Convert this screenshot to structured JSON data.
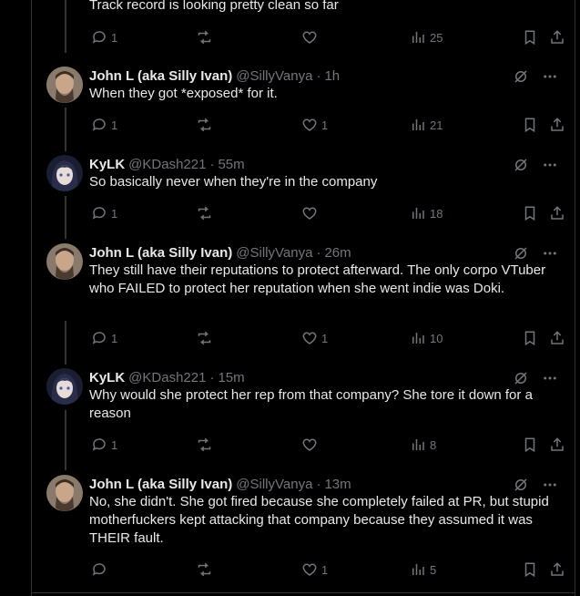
{
  "top_partial": {
    "text": "Track record is looking pretty clean so far",
    "replies": "1",
    "reposts": "",
    "likes": "",
    "views": "25"
  },
  "tweets": [
    {
      "name": "John L (aka Silly Ivan)",
      "handle": "@SillyVanya",
      "time": "1h",
      "text": "When they got *exposed* for it.",
      "replies": "1",
      "reposts": "",
      "likes": "1",
      "views": "21",
      "avatar": "man-avatar"
    },
    {
      "name": "KyLK",
      "handle": "@KDash221",
      "time": "55m",
      "text": "So basically never when they're in the company",
      "replies": "1",
      "reposts": "",
      "likes": "",
      "views": "18",
      "avatar": "anime-avatar"
    },
    {
      "name": "John L (aka Silly Ivan)",
      "handle": "@SillyVanya",
      "time": "26m",
      "text": "They still have their reputations to protect afterward. The only corpo VTuber who FAILED to protect her reputation when she went indie was Doki.",
      "replies": "1",
      "reposts": "",
      "likes": "1",
      "views": "10",
      "avatar": "man-avatar"
    },
    {
      "name": "KyLK",
      "handle": "@KDash221",
      "time": "15m",
      "text": "Why would she protect her rep from that company? She tore it down for a reason",
      "replies": "1",
      "reposts": "",
      "likes": "",
      "views": "8",
      "avatar": "anime-avatar"
    },
    {
      "name": "John L (aka Silly Ivan)",
      "handle": "@SillyVanya",
      "time": "13m",
      "text": "No, she didn't. She got fired because she completely failed at PR, but stupid motherfuckers kept attacking that company because they assumed it was THEIR fault.",
      "replies": "",
      "reposts": "",
      "likes": "1",
      "views": "5",
      "avatar": "man-avatar"
    }
  ],
  "colors": {
    "background": "#000000",
    "text": "#e7e9ea",
    "muted": "#71767b",
    "border": "#2f3336"
  }
}
